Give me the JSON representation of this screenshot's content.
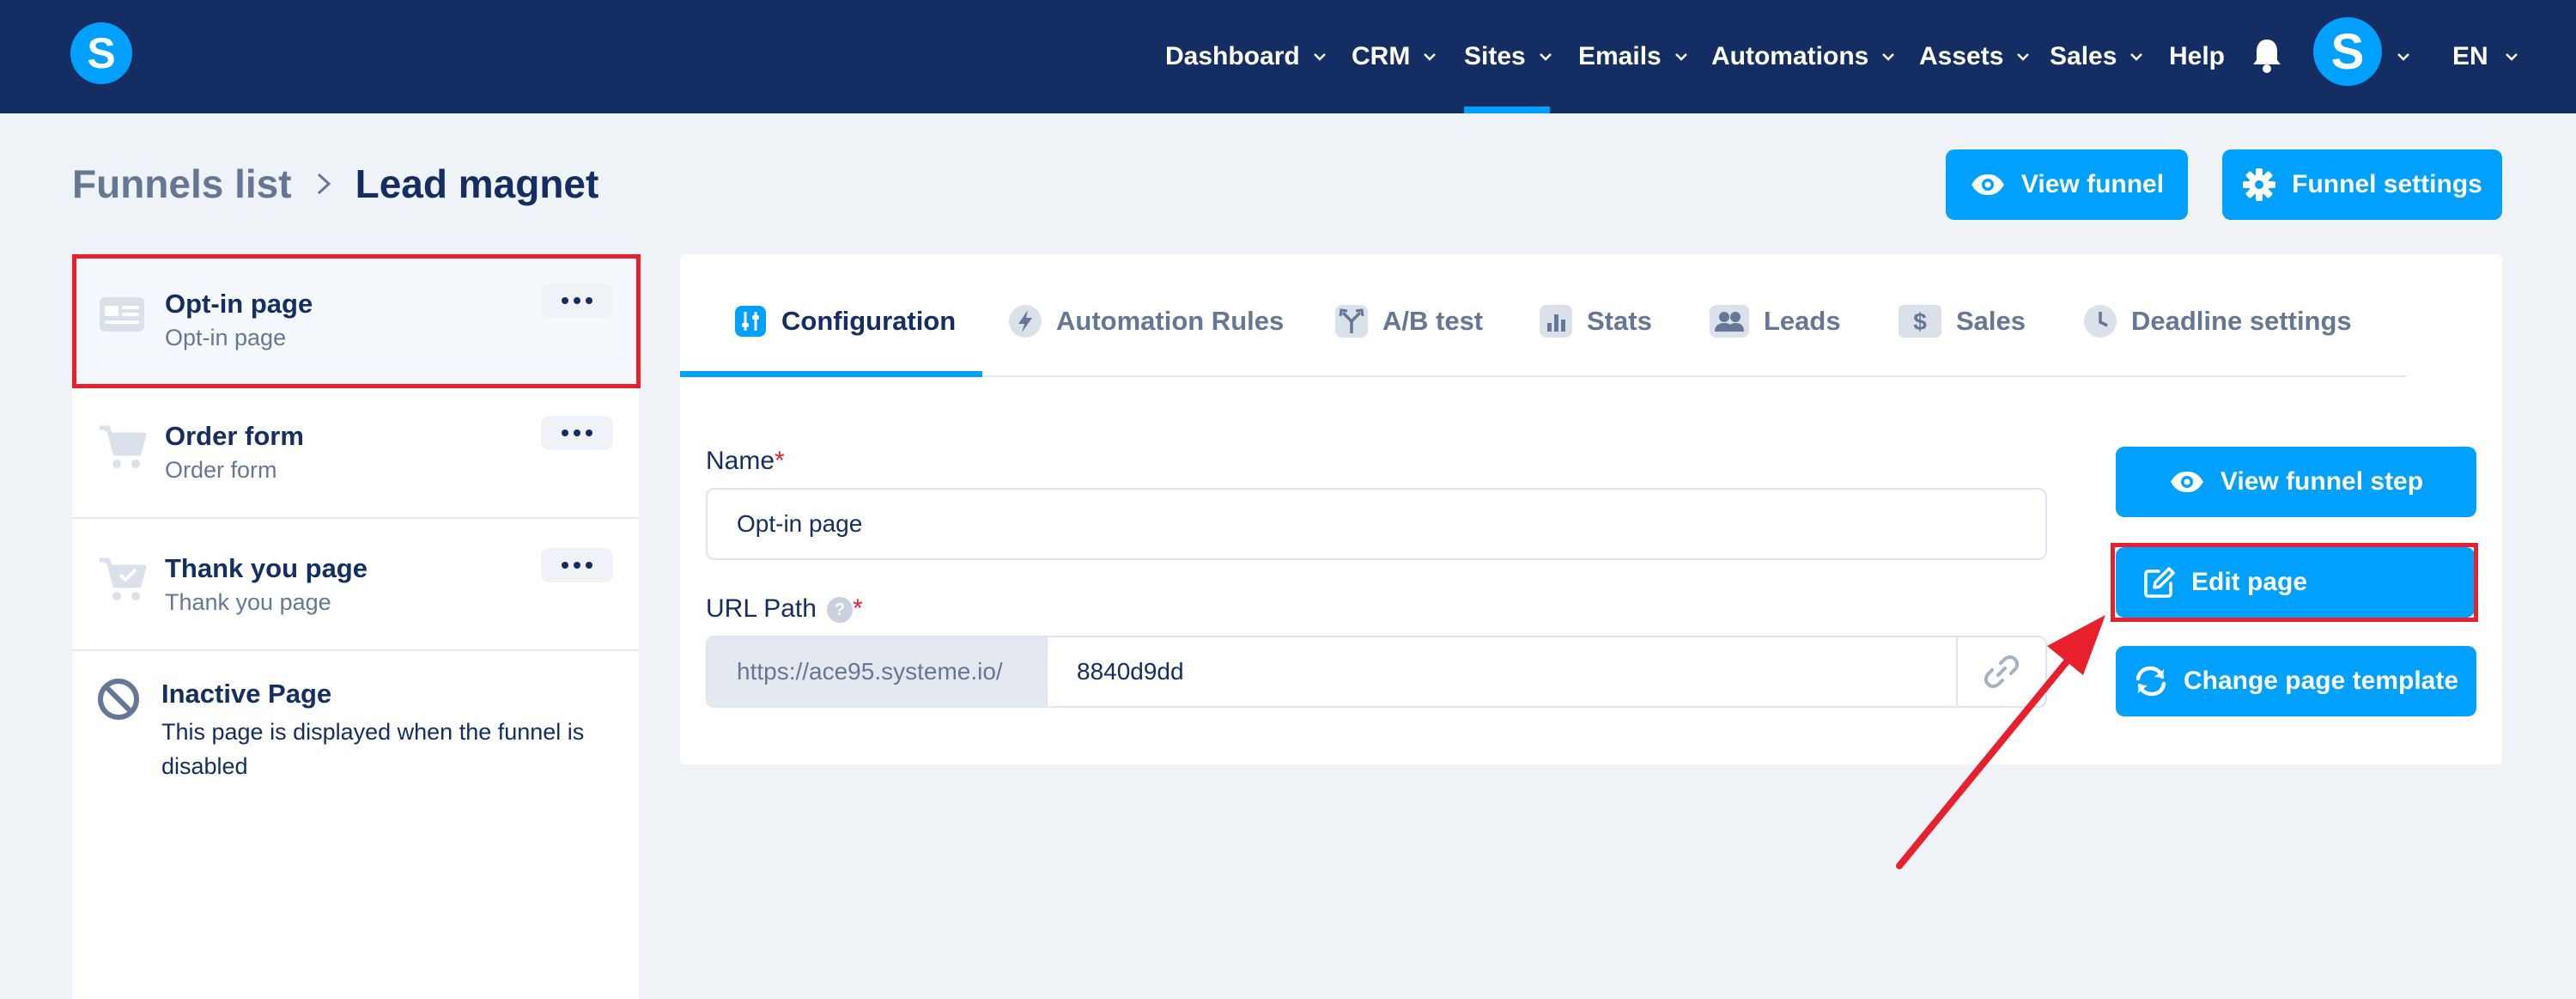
{
  "navbar": {
    "logo_letter": "S",
    "items": [
      {
        "label": "Dashboard",
        "has_dropdown": true
      },
      {
        "label": "CRM",
        "has_dropdown": true
      },
      {
        "label": "Sites",
        "has_dropdown": true,
        "active": true
      },
      {
        "label": "Emails",
        "has_dropdown": true
      },
      {
        "label": "Automations",
        "has_dropdown": true
      },
      {
        "label": "Assets",
        "has_dropdown": true
      },
      {
        "label": "Sales",
        "has_dropdown": true
      },
      {
        "label": "Help",
        "has_dropdown": false
      }
    ],
    "avatar_letter": "S",
    "language": "EN"
  },
  "breadcrumb": {
    "parent": "Funnels list",
    "current": "Lead magnet"
  },
  "header_buttons": {
    "view_funnel": "View funnel",
    "funnel_settings": "Funnel settings"
  },
  "sidebar": {
    "steps": [
      {
        "title": "Opt-in page",
        "subtitle": "Opt-in page",
        "icon": "page-icon"
      },
      {
        "title": "Order form",
        "subtitle": "Order form",
        "icon": "cart-icon"
      },
      {
        "title": "Thank you page",
        "subtitle": "Thank you page",
        "icon": "cart-check-icon"
      }
    ],
    "inactive": {
      "title": "Inactive Page",
      "description": "This page is displayed when the funnel is disabled",
      "icon": "ban-icon"
    }
  },
  "tabs": [
    {
      "label": "Configuration",
      "icon": "sliders-icon",
      "active": true
    },
    {
      "label": "Automation Rules",
      "icon": "bolt-icon"
    },
    {
      "label": "A/B test",
      "icon": "split-icon"
    },
    {
      "label": "Stats",
      "icon": "bar-chart-icon"
    },
    {
      "label": "Leads",
      "icon": "users-icon"
    },
    {
      "label": "Sales",
      "icon": "dollar-icon"
    },
    {
      "label": "Deadline settings",
      "icon": "clock-icon"
    }
  ],
  "form": {
    "name_label": "Name",
    "name_value": "Opt-in page",
    "url_label": "URL Path",
    "url_prefix": "https://ace95.systeme.io/",
    "url_value": "8840d9dd",
    "required_mark": "*",
    "help_mark": "?"
  },
  "actions": {
    "view_step": "View funnel step",
    "edit_page": "Edit page",
    "change_template": "Change page template"
  },
  "colors": {
    "navbar": "#142d63",
    "accent": "#00a0ff",
    "highlight": "#e8202d",
    "background": "#eff3f8"
  }
}
